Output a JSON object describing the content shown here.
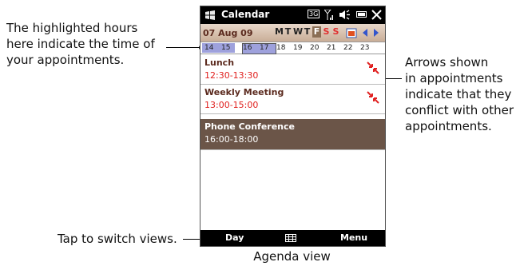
{
  "titlebar": {
    "app_title": "Calendar",
    "network": "3G",
    "icons": [
      "windows-logo-icon",
      "network-3g-icon",
      "signal-icon",
      "volume-icon",
      "battery-icon",
      "close-icon"
    ]
  },
  "datebar": {
    "date": "07 Aug 09",
    "days": [
      "M",
      "T",
      "W",
      "T",
      "F",
      "S",
      "S"
    ],
    "selected_day_index": 4
  },
  "hours": [
    "14",
    "15",
    "16",
    "17",
    "18",
    "19",
    "20",
    "21",
    "22",
    "23"
  ],
  "appointments": [
    {
      "title": "Lunch",
      "time": "12:30-13:30",
      "conflict": true
    },
    {
      "title": "Weekly Meeting",
      "time": "13:00-15:00",
      "conflict": true
    },
    {
      "title": "Phone Conference",
      "time": "16:00-18:00",
      "conflict": false
    }
  ],
  "softkeys": {
    "left": "Day",
    "right": "Menu"
  },
  "callouts": {
    "hours": "The highlighted hours here indicate the time of your appointments.",
    "hours_l1": "The highlighted hours",
    "hours_l2": "here indicate the time of",
    "hours_l3": "your appointments.",
    "arrows_l1": "Arrows shown",
    "arrows_l2": "in appointments",
    "arrows_l3": "indicate that they",
    "arrows_l4": "conflict with other",
    "arrows_l5": "appointments.",
    "switch": "Tap to switch views."
  },
  "caption": "Agenda view",
  "colors": {
    "title_text": "#5b2a1e",
    "time_text": "#e0201e",
    "highlight": "#9ea1dc",
    "selected": "#6b5548"
  }
}
